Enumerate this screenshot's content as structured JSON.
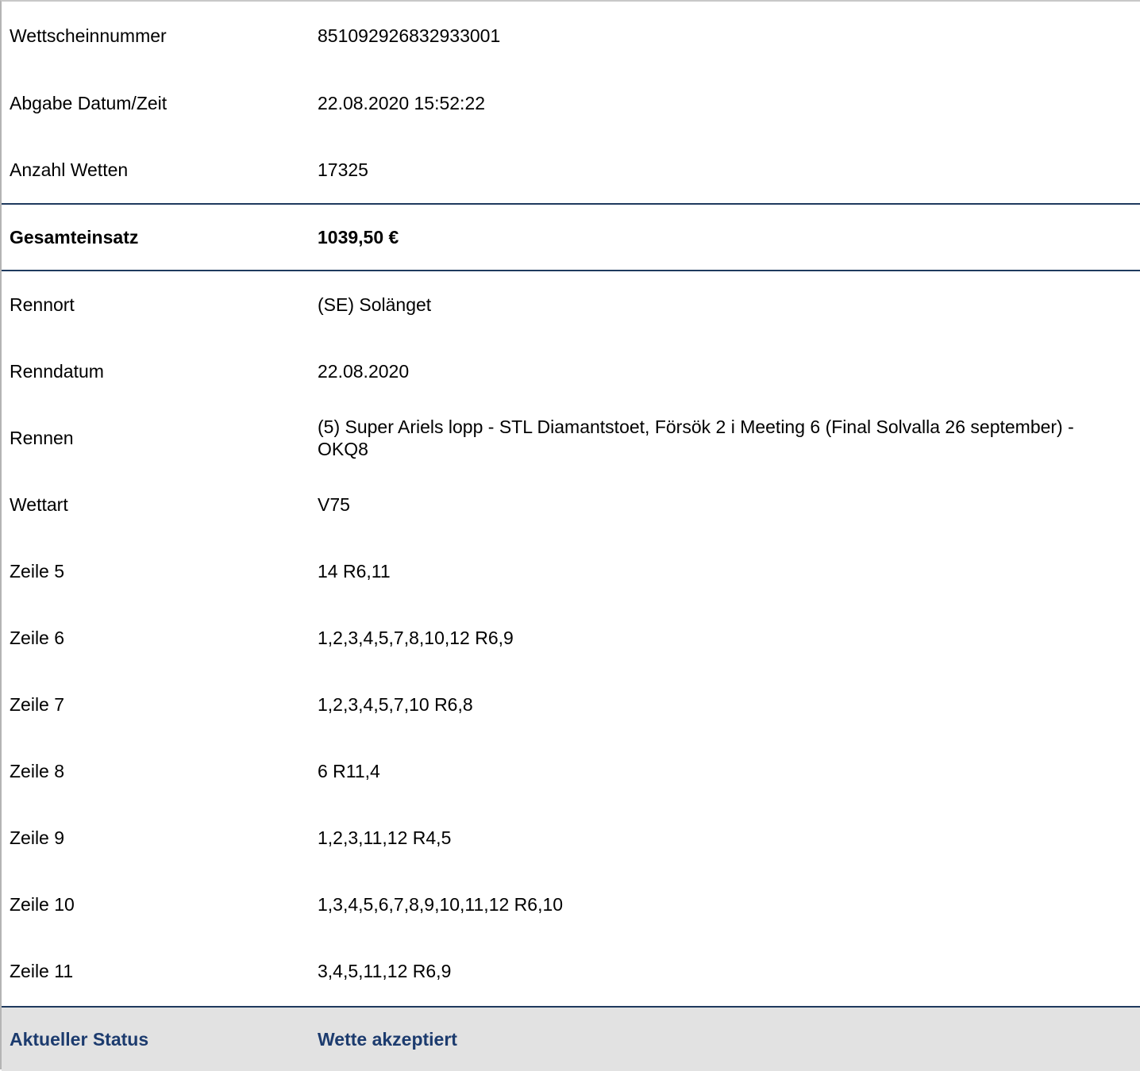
{
  "ticket_info": [
    {
      "label": "Wettscheinnummer",
      "value": "851092926832933001"
    },
    {
      "label": "Abgabe Datum/Zeit",
      "value": "22.08.2020 15:52:22"
    },
    {
      "label": "Anzahl Wetten",
      "value": "17325"
    }
  ],
  "total": {
    "label": "Gesamteinsatz",
    "value": "1039,50 €"
  },
  "race_info": [
    {
      "label": "Rennort",
      "value": "(SE) Solänget"
    },
    {
      "label": "Renndatum",
      "value": "22.08.2020"
    },
    {
      "label": "Rennen",
      "value": "(5) Super Ariels lopp - STL Diamantstoet, Försök 2 i Meeting 6 (Final Solvalla 26 september) - OKQ8"
    },
    {
      "label": "Wettart",
      "value": "V75"
    }
  ],
  "lines": [
    {
      "label": "Zeile 5",
      "value": "14 R6,11"
    },
    {
      "label": "Zeile 6",
      "value": "1,2,3,4,5,7,8,10,12 R6,9"
    },
    {
      "label": "Zeile 7",
      "value": "1,2,3,4,5,7,10 R6,8"
    },
    {
      "label": "Zeile 8",
      "value": "6 R11,4"
    },
    {
      "label": "Zeile 9",
      "value": "1,2,3,11,12 R4,5"
    },
    {
      "label": "Zeile 10",
      "value": "1,3,4,5,6,7,8,9,10,11,12 R6,10"
    },
    {
      "label": "Zeile 11",
      "value": "3,4,5,11,12 R6,9"
    }
  ],
  "status": {
    "label": "Aktueller Status",
    "value": "Wette akzeptiert"
  },
  "colors": {
    "accent": "#1c3b6e",
    "divider": "#1f3a5e",
    "status_bg": "#e2e2e2"
  }
}
